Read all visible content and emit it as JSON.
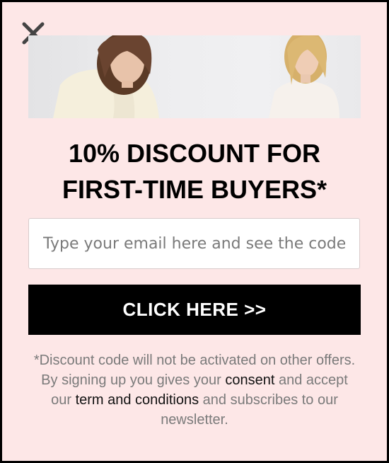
{
  "popup": {
    "close_icon": "close-icon",
    "hero_image": "two-women-fashion-photo",
    "headline_line1": "10% DISCOUNT FOR",
    "headline_line2": "FIRST-TIME BUYERS*",
    "email_placeholder": "Type your email here and see the code",
    "cta_label": "CLICK HERE >>",
    "terms": {
      "part1": "*Discount code will not be activated on other offers. By signing up you gives your ",
      "consent_link": "consent",
      "part2": " and accept our ",
      "terms_link": "term and conditions",
      "part3": " and subscribes to our newsletter."
    }
  },
  "colors": {
    "background": "#fde7e7",
    "button": "#000000",
    "button_text": "#ffffff",
    "muted_text": "#7a7a7a"
  }
}
